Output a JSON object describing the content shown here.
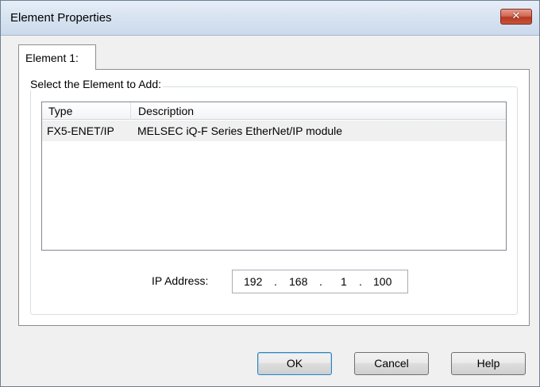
{
  "window": {
    "title": "Element Properties",
    "close_glyph": "✕"
  },
  "tabs": [
    {
      "label": "Element 1:",
      "selected": true
    }
  ],
  "group": {
    "label": "Select the Element to Add:"
  },
  "list": {
    "columns": [
      "Type",
      "Description"
    ],
    "rows": [
      {
        "type": "FX5-ENET/IP",
        "description": "MELSEC iQ-F Series EtherNet/IP module",
        "selected": true
      }
    ]
  },
  "ip": {
    "label": "IP Address:",
    "octets": [
      "192",
      "168",
      "1",
      "100"
    ],
    "separator": "."
  },
  "buttons": {
    "ok": "OK",
    "cancel": "Cancel",
    "help": "Help"
  },
  "colors": {
    "titlebar": "#d9e4f1",
    "close_button": "#c6543a",
    "selected_row": "#f0f0f0",
    "default_button_border": "#3c7fb1"
  }
}
